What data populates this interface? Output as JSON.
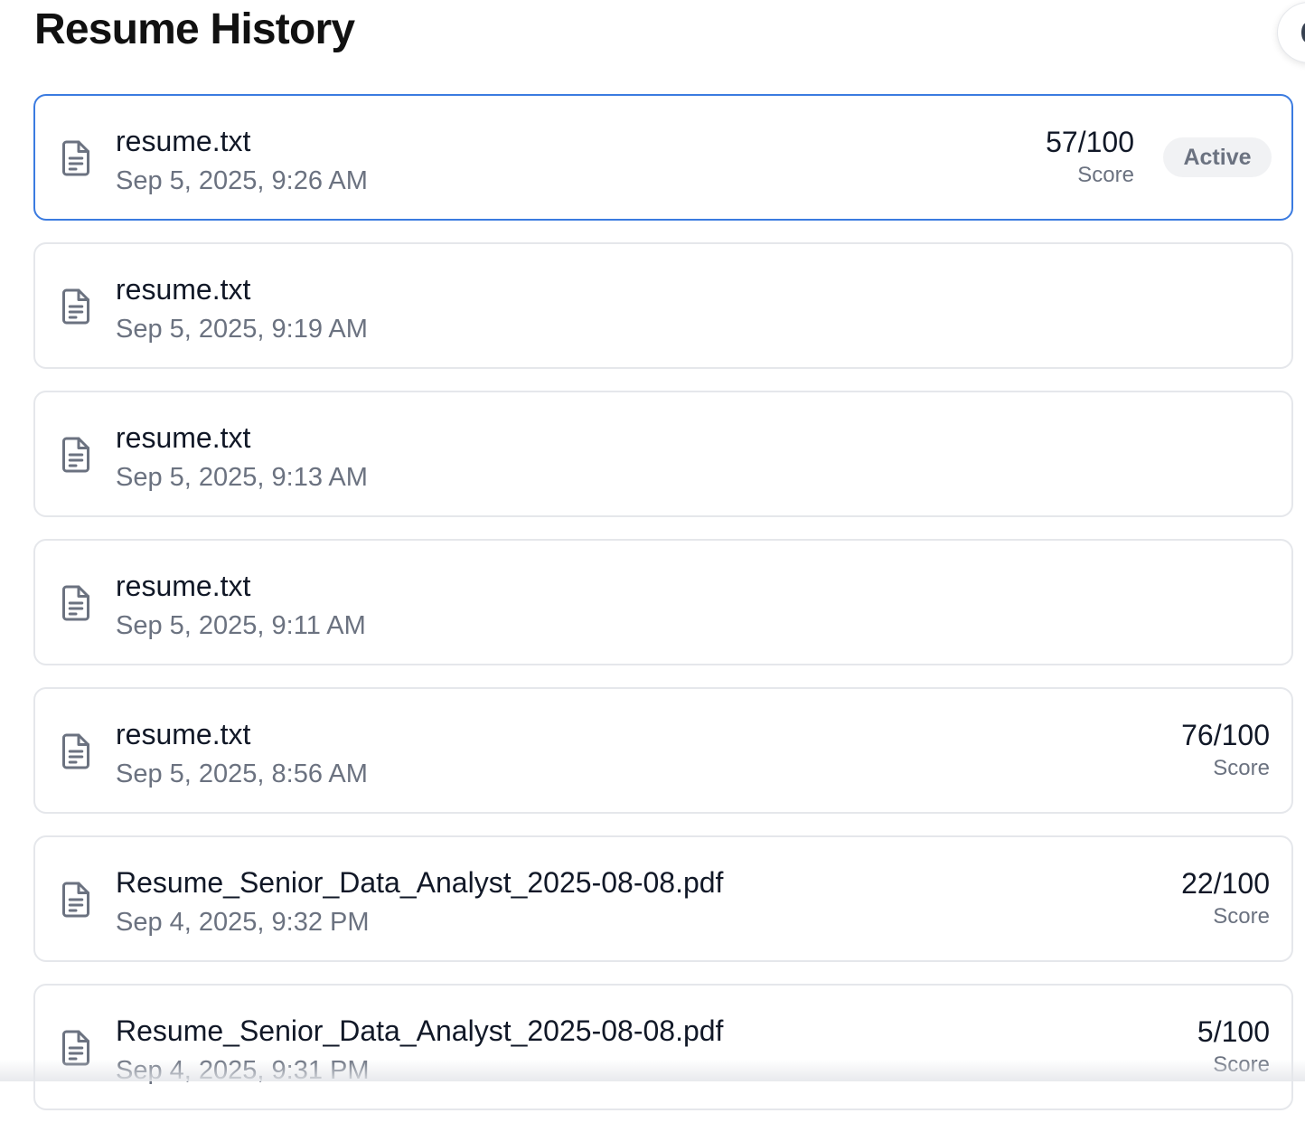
{
  "header": {
    "title": "Resume History"
  },
  "history": [
    {
      "file_name": "resume.txt",
      "date": "Sep 5, 2025, 9:26 AM",
      "score": "57/100",
      "score_label": "Score",
      "badge": "Active",
      "active": true
    },
    {
      "file_name": "resume.txt",
      "date": "Sep 5, 2025, 9:19 AM",
      "score": null,
      "score_label": null,
      "badge": null,
      "active": false
    },
    {
      "file_name": "resume.txt",
      "date": "Sep 5, 2025, 9:13 AM",
      "score": null,
      "score_label": null,
      "badge": null,
      "active": false
    },
    {
      "file_name": "resume.txt",
      "date": "Sep 5, 2025, 9:11 AM",
      "score": null,
      "score_label": null,
      "badge": null,
      "active": false
    },
    {
      "file_name": "resume.txt",
      "date": "Sep 5, 2025, 8:56 AM",
      "score": "76/100",
      "score_label": "Score",
      "badge": null,
      "active": false
    },
    {
      "file_name": "Resume_Senior_Data_Analyst_2025-08-08.pdf",
      "date": "Sep 4, 2025, 9:32 PM",
      "score": "22/100",
      "score_label": "Score",
      "badge": null,
      "active": false
    },
    {
      "file_name": "Resume_Senior_Data_Analyst_2025-08-08.pdf",
      "date": "Sep 4, 2025, 9:31 PM",
      "score": "5/100",
      "score_label": "Score",
      "badge": null,
      "active": false
    }
  ],
  "icons": {
    "item_icon": "document-icon"
  },
  "colors": {
    "active_border": "#3b7be0",
    "muted_text": "#6b7280",
    "badge_bg": "#f1f2f4"
  }
}
